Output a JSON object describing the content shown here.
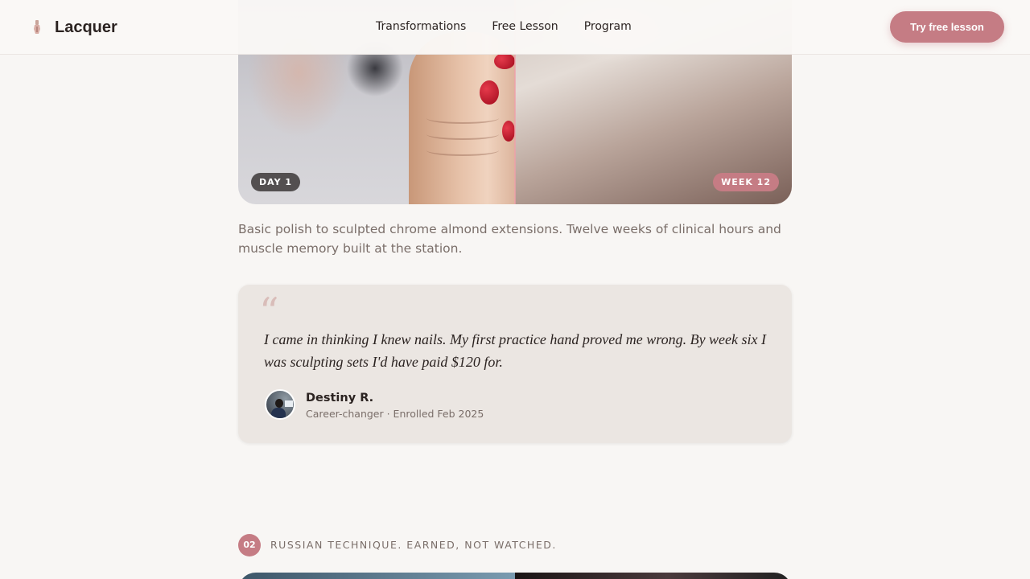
{
  "header": {
    "brand": "Lacquer",
    "nav": [
      "Transformations",
      "Free Lesson",
      "Program"
    ],
    "cta": "Try free lesson"
  },
  "transformation": {
    "before_label": "DAY 1",
    "after_label": "WEEK 12",
    "description": "Basic polish to sculpted chrome almond extensions. Twelve weeks of clinical hours and muscle memory built at the station."
  },
  "testimonial": {
    "quote_mark": "“",
    "quote": "I came in thinking I knew nails. My first practice hand proved me wrong. By week six I was sculpting sets I'd have paid $120 for.",
    "author": "Destiny R.",
    "meta": "Career-changer · Enrolled Feb 2025"
  },
  "section_next": {
    "number": "02",
    "label": "RUSSIAN TECHNIQUE. EARNED, NOT WATCHED."
  },
  "colors": {
    "accent": "#c57c84",
    "background": "#f8f6f4",
    "card": "#ebe6e2",
    "text": "#2b2321",
    "muted": "#7a6e69"
  },
  "icons": {
    "brand": "nail-brush-icon"
  }
}
